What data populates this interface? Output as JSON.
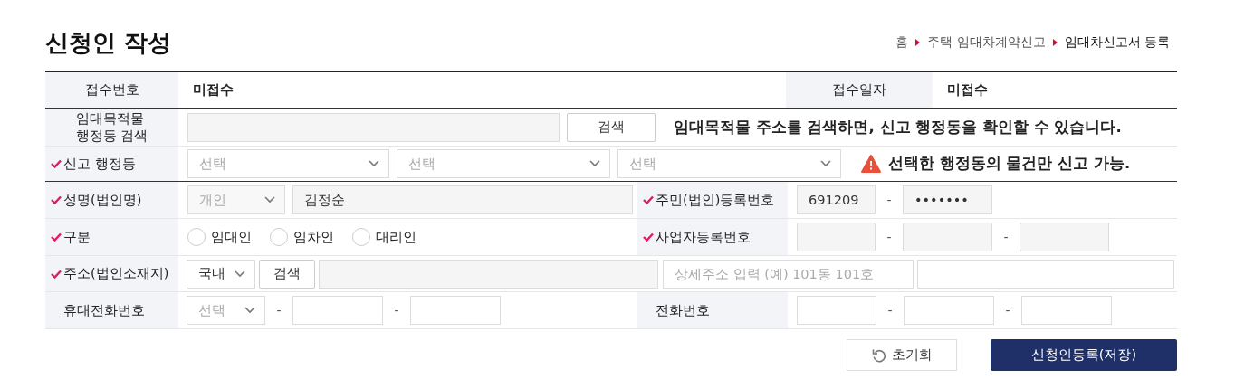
{
  "page_title": "신청인 작성",
  "breadcrumb": [
    {
      "label": "홈",
      "selected": false
    },
    {
      "label": "주택 임대차계약신고",
      "selected": false
    },
    {
      "label": "임대차신고서 등록",
      "selected": true
    }
  ],
  "receipt": {
    "number_label": "접수번호",
    "number_value": "미접수",
    "date_label": "접수일자",
    "date_value": "미접수"
  },
  "address_search": {
    "label": "임대목적물\n행정동 검색",
    "button": "검색",
    "notice": "임대목적물 주소를 검색하면, 신고 행정동을 확인할 수 있습니다."
  },
  "admin_dong": {
    "label": "신고 행정동",
    "required": true,
    "selects": [
      {
        "placeholder": "선택"
      },
      {
        "placeholder": "선택"
      },
      {
        "placeholder": "선택"
      }
    ],
    "warning": "선택한 행정동의 물건만 신고 가능."
  },
  "name": {
    "label": "성명(법인명)",
    "required": true,
    "type_select": {
      "value": "개인",
      "disabled": true
    },
    "value": "김정순"
  },
  "resident_no": {
    "label": "주민(법인)등록번호",
    "required": true,
    "first": "691209",
    "separator": "-",
    "second": "•••••••"
  },
  "category": {
    "label": "구분",
    "required": true,
    "options": [
      {
        "label": "임대인",
        "selected": false
      },
      {
        "label": "임차인",
        "selected": false
      },
      {
        "label": "대리인",
        "selected": false
      }
    ]
  },
  "business_no": {
    "label": "사업자등록번호",
    "required": true,
    "separators": [
      "-",
      "-"
    ]
  },
  "address": {
    "label": "주소(법인소재지)",
    "required": true,
    "region_select": "국내",
    "button": "검색",
    "detail_placeholder": "상세주소 입력 (예) 101동 101호"
  },
  "mobile": {
    "label": "휴대전화번호",
    "required": false,
    "carrier_placeholder": "선택",
    "separators": [
      "-",
      "-"
    ]
  },
  "phone": {
    "label": "전화번호",
    "required": false,
    "separators": [
      "-",
      "-"
    ]
  },
  "buttons": {
    "reset": "초기화",
    "submit": "신청인등록(저장)"
  }
}
